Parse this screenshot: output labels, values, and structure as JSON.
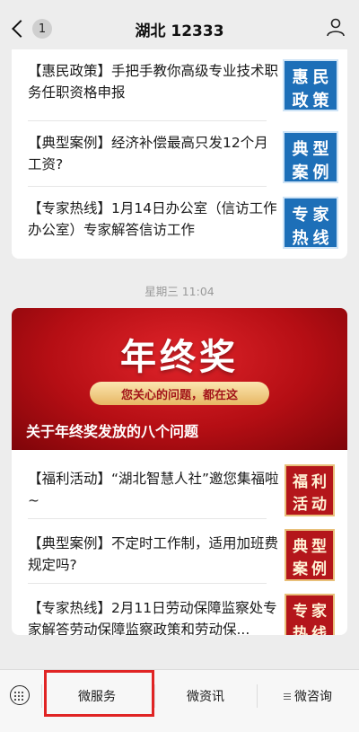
{
  "nav": {
    "badge": "1",
    "title": "湖北 12333"
  },
  "card1": {
    "items": [
      {
        "text": "【惠民政策】手把手教你高级专业技术职务任职资格申报",
        "thumb": [
          "惠",
          "民",
          "政",
          "策"
        ],
        "thumb_color": "#1d6fb8"
      },
      {
        "text": "【典型案例】经济补偿最高只发12个月工资?",
        "thumb": [
          "典",
          "型",
          "案",
          "例"
        ],
        "thumb_color": "#1d6fb8"
      },
      {
        "text": "【专家热线】1月14日办公室（信访工作办公室）专家解答信访工作",
        "thumb": [
          "专",
          "家",
          "热",
          "线"
        ],
        "thumb_color": "#1d6fb8"
      }
    ]
  },
  "timestamp": "星期三 11:04",
  "card2": {
    "banner": {
      "title": "年终奖",
      "pill": "您关心的问题，都在这",
      "caption": "关于年终奖发放的八个问题"
    },
    "items": [
      {
        "text": "【福利活动】“湖北智慧人社”邀您集福啦~",
        "thumb": [
          "福",
          "利",
          "活",
          "动"
        ],
        "thumb_color": "#b4161b"
      },
      {
        "text": "【典型案例】不定时工作制，适用加班费规定吗?",
        "thumb": [
          "典",
          "型",
          "案",
          "例"
        ],
        "thumb_color": "#b4161b"
      },
      {
        "text": "【专家热线】2月11日劳动保障监察处专家解答劳动保障监察政策和劳动保...",
        "thumb": [
          "专",
          "家",
          "热",
          "线"
        ],
        "thumb_color": "#b4161b"
      }
    ]
  },
  "tabbar": {
    "tabs": [
      {
        "label": "微服务",
        "highlighted": true
      },
      {
        "label": "微资讯"
      },
      {
        "label": "微咨询",
        "has_menu_icon": true
      }
    ],
    "highlight_color": "#e02424"
  },
  "icons": {
    "back": "chevron-left-icon",
    "user": "user-icon",
    "keyboard": "keyboard-icon"
  }
}
